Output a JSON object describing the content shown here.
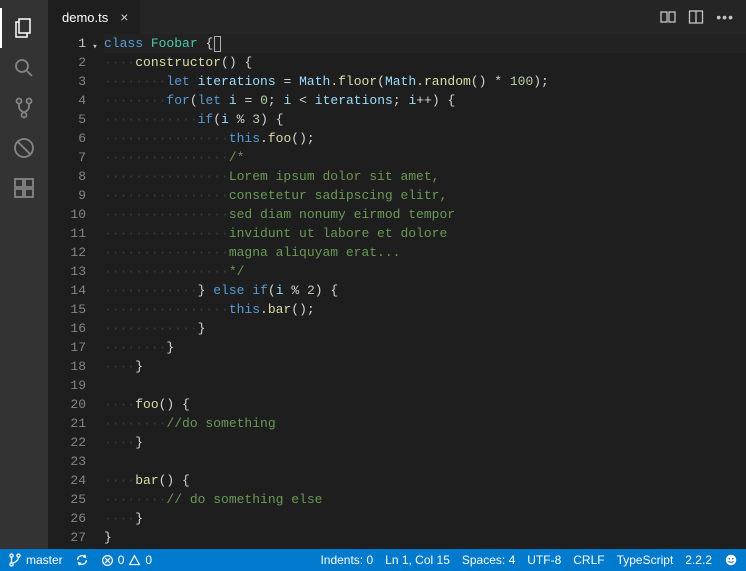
{
  "tab": {
    "filename": "demo.ts"
  },
  "activity": {
    "items": [
      "explorer",
      "search",
      "git",
      "debug",
      "extensions"
    ]
  },
  "gutter": {
    "lines": 27,
    "active": 1
  },
  "code": {
    "lines": [
      [
        [
          "kw",
          "class"
        ],
        [
          "op",
          " "
        ],
        [
          "cls",
          "Foobar"
        ],
        [
          "op",
          " "
        ],
        [
          "pun",
          "{"
        ],
        [
          "cursor",
          ""
        ]
      ],
      [
        [
          "ws",
          "····"
        ],
        [
          "fn",
          "constructor"
        ],
        [
          "pun",
          "()"
        ],
        [
          "op",
          " "
        ],
        [
          "pun",
          "{"
        ]
      ],
      [
        [
          "ws",
          "········"
        ],
        [
          "kw",
          "let"
        ],
        [
          "op",
          " "
        ],
        [
          "id",
          "iterations"
        ],
        [
          "op",
          " "
        ],
        [
          "pun",
          "="
        ],
        [
          "op",
          " "
        ],
        [
          "id",
          "Math"
        ],
        [
          "pun",
          "."
        ],
        [
          "fn",
          "floor"
        ],
        [
          "pun",
          "("
        ],
        [
          "id",
          "Math"
        ],
        [
          "pun",
          "."
        ],
        [
          "fn",
          "random"
        ],
        [
          "pun",
          "()"
        ],
        [
          "op",
          " "
        ],
        [
          "pun",
          "*"
        ],
        [
          "op",
          " "
        ],
        [
          "num",
          "100"
        ],
        [
          "pun",
          ");"
        ]
      ],
      [
        [
          "ws",
          "········"
        ],
        [
          "kw",
          "for"
        ],
        [
          "pun",
          "("
        ],
        [
          "kw",
          "let"
        ],
        [
          "op",
          " "
        ],
        [
          "id",
          "i"
        ],
        [
          "op",
          " "
        ],
        [
          "pun",
          "="
        ],
        [
          "op",
          " "
        ],
        [
          "num",
          "0"
        ],
        [
          "pun",
          ";"
        ],
        [
          "op",
          " "
        ],
        [
          "id",
          "i"
        ],
        [
          "op",
          " "
        ],
        [
          "pun",
          "<"
        ],
        [
          "op",
          " "
        ],
        [
          "id",
          "iterations"
        ],
        [
          "pun",
          ";"
        ],
        [
          "op",
          " "
        ],
        [
          "id",
          "i"
        ],
        [
          "pun",
          "++)"
        ],
        [
          "op",
          " "
        ],
        [
          "pun",
          "{"
        ]
      ],
      [
        [
          "ws",
          "············"
        ],
        [
          "kw",
          "if"
        ],
        [
          "pun",
          "("
        ],
        [
          "id",
          "i"
        ],
        [
          "op",
          " "
        ],
        [
          "pun",
          "%"
        ],
        [
          "op",
          " "
        ],
        [
          "num",
          "3"
        ],
        [
          "pun",
          ")"
        ],
        [
          "op",
          " "
        ],
        [
          "pun",
          "{"
        ]
      ],
      [
        [
          "ws",
          "················"
        ],
        [
          "this",
          "this"
        ],
        [
          "pun",
          "."
        ],
        [
          "fn",
          "foo"
        ],
        [
          "pun",
          "();"
        ]
      ],
      [
        [
          "ws",
          "················"
        ],
        [
          "cmt",
          "/*"
        ]
      ],
      [
        [
          "ws",
          "················"
        ],
        [
          "cmt",
          "Lorem ipsum dolor sit amet,"
        ]
      ],
      [
        [
          "ws",
          "················"
        ],
        [
          "cmt",
          "consetetur sadipscing elitr,"
        ]
      ],
      [
        [
          "ws",
          "················"
        ],
        [
          "cmt",
          "sed diam nonumy eirmod tempor"
        ]
      ],
      [
        [
          "ws",
          "················"
        ],
        [
          "cmt",
          "invidunt ut labore et dolore"
        ]
      ],
      [
        [
          "ws",
          "················"
        ],
        [
          "cmt",
          "magna aliquyam erat..."
        ]
      ],
      [
        [
          "ws",
          "················"
        ],
        [
          "cmt",
          "*/"
        ]
      ],
      [
        [
          "ws",
          "············"
        ],
        [
          "pun",
          "}"
        ],
        [
          "op",
          " "
        ],
        [
          "kw",
          "else"
        ],
        [
          "op",
          " "
        ],
        [
          "kw",
          "if"
        ],
        [
          "pun",
          "("
        ],
        [
          "id",
          "i"
        ],
        [
          "op",
          " "
        ],
        [
          "pun",
          "%"
        ],
        [
          "op",
          " "
        ],
        [
          "num",
          "2"
        ],
        [
          "pun",
          ")"
        ],
        [
          "op",
          " "
        ],
        [
          "pun",
          "{"
        ]
      ],
      [
        [
          "ws",
          "················"
        ],
        [
          "this",
          "this"
        ],
        [
          "pun",
          "."
        ],
        [
          "fn",
          "bar"
        ],
        [
          "pun",
          "();"
        ]
      ],
      [
        [
          "ws",
          "············"
        ],
        [
          "pun",
          "}"
        ]
      ],
      [
        [
          "ws",
          "········"
        ],
        [
          "pun",
          "}"
        ]
      ],
      [
        [
          "ws",
          "····"
        ],
        [
          "pun",
          "}"
        ]
      ],
      [
        [
          "op",
          ""
        ]
      ],
      [
        [
          "ws",
          "····"
        ],
        [
          "fn",
          "foo"
        ],
        [
          "pun",
          "()"
        ],
        [
          "op",
          " "
        ],
        [
          "pun",
          "{"
        ]
      ],
      [
        [
          "ws",
          "········"
        ],
        [
          "cmt",
          "//do something"
        ]
      ],
      [
        [
          "ws",
          "····"
        ],
        [
          "pun",
          "}"
        ]
      ],
      [
        [
          "op",
          ""
        ]
      ],
      [
        [
          "ws",
          "····"
        ],
        [
          "fn",
          "bar"
        ],
        [
          "pun",
          "()"
        ],
        [
          "op",
          " "
        ],
        [
          "pun",
          "{"
        ]
      ],
      [
        [
          "ws",
          "········"
        ],
        [
          "cmt",
          "// do something else"
        ]
      ],
      [
        [
          "ws",
          "····"
        ],
        [
          "pun",
          "}"
        ]
      ],
      [
        [
          "pun",
          "}"
        ]
      ]
    ]
  },
  "status": {
    "branch": "master",
    "errors": "0",
    "warnings": "0",
    "indents": "Indents: 0",
    "position": "Ln 1, Col 15",
    "spaces": "Spaces: 4",
    "encoding": "UTF-8",
    "eol": "CRLF",
    "language": "TypeScript",
    "version": "2.2.2"
  }
}
